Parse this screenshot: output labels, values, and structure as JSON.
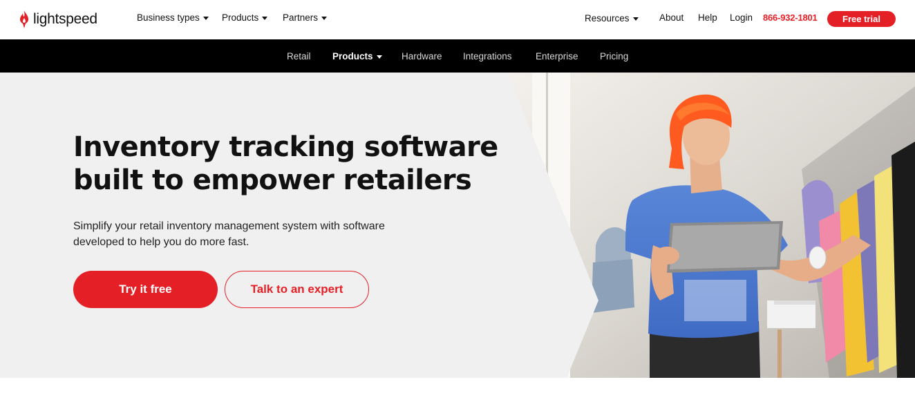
{
  "brand": {
    "name": "lightspeed",
    "color": "#e51f26"
  },
  "topnav": {
    "items": [
      {
        "label": "Business types",
        "has_caret": true
      },
      {
        "label": "Products",
        "has_caret": true
      },
      {
        "label": "Partners",
        "has_caret": true
      }
    ],
    "right_items": [
      {
        "label": "Resources",
        "has_caret": true
      },
      {
        "label": "About"
      },
      {
        "label": "Help"
      },
      {
        "label": "Login"
      }
    ],
    "phone": "866-932-1801",
    "cta": "Free trial"
  },
  "subnav": {
    "items": [
      {
        "label": "Retail"
      },
      {
        "label": "Products",
        "active": true
      },
      {
        "label": "Hardware"
      },
      {
        "label": "Integrations"
      },
      {
        "label": "Enterprise"
      },
      {
        "label": "Pricing"
      }
    ]
  },
  "hero": {
    "title": "Inventory tracking software built to empower retailers",
    "subtitle": "Simplify your retail inventory management system with software developed to help you do more fast.",
    "primary_button": "Try it free",
    "secondary_button": "Talk to an expert"
  }
}
